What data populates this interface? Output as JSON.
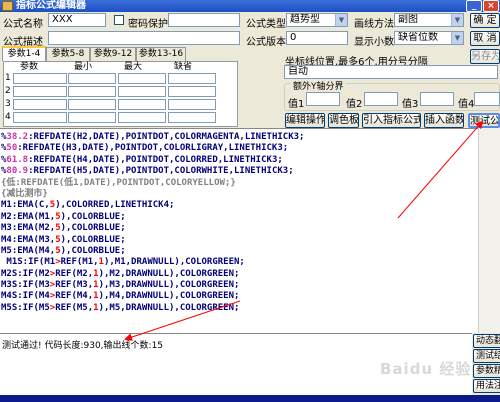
{
  "window": {
    "title": "指标公式编辑器"
  },
  "form": {
    "name_label": "公式名称",
    "name_value": "XXX",
    "password_label": "密码保护",
    "desc_label": "公式描述",
    "type_label": "公式类型",
    "type_value": "趋势型",
    "draw_label": "画线方法",
    "draw_value": "副图",
    "version_label": "公式版本",
    "version_value": "0",
    "decimal_label": "显示小数",
    "decimal_value": "缺省位数",
    "ok_label": "确 定",
    "cancel_label": "取 消",
    "saveas_label": "另存为"
  },
  "tabs": [
    "参数1-4",
    "参数5-8",
    "参数9-12",
    "参数13-16"
  ],
  "param_grid": {
    "headers": [
      "参数",
      "最小",
      "最大",
      "缺省"
    ],
    "rows": [
      "1",
      "2",
      "3",
      "4"
    ]
  },
  "coord": {
    "label": "坐标线位置,最多6个,用分号分隔",
    "value": "自动"
  },
  "axis_group": {
    "title": "额外Y轴分界",
    "labels": [
      "值1",
      "值2",
      "值3",
      "值4"
    ]
  },
  "actions": [
    "编辑操作",
    "调色板",
    "引入指标公式",
    "插入函数",
    "测试公式"
  ],
  "code_lines": [
    [
      {
        "t": "%",
        "c": "kw-dark"
      },
      {
        "t": "38.2",
        "c": "kw-mag"
      },
      {
        "t": ":REFDATE(H2,DATE),POINTDOT,COLORMAGENTA,LINETHICK3;",
        "c": "kw-dark"
      }
    ],
    [
      {
        "t": "%",
        "c": "kw-dark"
      },
      {
        "t": "50",
        "c": "kw-mag"
      },
      {
        "t": ":REFDATE(H3,DATE),POINTDOT,COLORLIGRAY,LINETHICK3;",
        "c": "kw-dark"
      }
    ],
    [
      {
        "t": "%",
        "c": "kw-dark"
      },
      {
        "t": "61.8",
        "c": "kw-mag"
      },
      {
        "t": ":REFDATE(H4,DATE),POINTDOT,COLORRED,LINETHICK3;",
        "c": "kw-dark"
      }
    ],
    [
      {
        "t": "%",
        "c": "kw-dark"
      },
      {
        "t": "80.9",
        "c": "kw-mag"
      },
      {
        "t": ":REFDATE(H5,DATE),POINTDOT,COLORWHITE,LINETHICK3;",
        "c": "kw-dark"
      }
    ],
    [
      {
        "t": "{低:REFDATE(低1,DATE),POINTDOT,COLORYELLOW;}",
        "c": "kw-gray"
      }
    ],
    [
      {
        "t": "{减比测市}",
        "c": "kw-gray"
      }
    ],
    [
      {
        "t": "M1:EMA(C,",
        "c": "kw-dark"
      },
      {
        "t": "5",
        "c": "kw-red"
      },
      {
        "t": "),COLORRED,LINETHICK4;",
        "c": "kw-dark"
      }
    ],
    [
      {
        "t": "M2:EMA(M1,",
        "c": "kw-dark"
      },
      {
        "t": "5",
        "c": "kw-red"
      },
      {
        "t": "),COLORBLUE;",
        "c": "kw-dark"
      }
    ],
    [
      {
        "t": "M3:EMA(M2,",
        "c": "kw-dark"
      },
      {
        "t": "5",
        "c": "kw-red"
      },
      {
        "t": "),COLORBLUE;",
        "c": "kw-dark"
      }
    ],
    [
      {
        "t": "M4:EMA(M3,",
        "c": "kw-dark"
      },
      {
        "t": "5",
        "c": "kw-red"
      },
      {
        "t": "),COLORBLUE;",
        "c": "kw-dark"
      }
    ],
    [
      {
        "t": "M5:EMA(M4,",
        "c": "kw-dark"
      },
      {
        "t": "5",
        "c": "kw-red"
      },
      {
        "t": "),COLORBLUE;",
        "c": "kw-dark"
      }
    ],
    [
      {
        "t": " M1S:IF(M1",
        "c": "kw-dark"
      },
      {
        "t": ">",
        "c": "kw-red"
      },
      {
        "t": "REF(M1,",
        "c": "kw-dark"
      },
      {
        "t": "1",
        "c": "kw-red"
      },
      {
        "t": "),M1,DRAWNULL),COLORGREEN;",
        "c": "kw-dark"
      }
    ],
    [
      {
        "t": "M2S:IF(M2",
        "c": "kw-dark"
      },
      {
        "t": ">",
        "c": "kw-red"
      },
      {
        "t": "REF(M2,",
        "c": "kw-dark"
      },
      {
        "t": "1",
        "c": "kw-red"
      },
      {
        "t": "),M2,DRAWNULL),COLORGREEN;",
        "c": "kw-dark"
      }
    ],
    [
      {
        "t": "M3S:IF(M3",
        "c": "kw-dark"
      },
      {
        "t": ">",
        "c": "kw-red"
      },
      {
        "t": "REF(M3,",
        "c": "kw-dark"
      },
      {
        "t": "1",
        "c": "kw-red"
      },
      {
        "t": "),M3,DRAWNULL),COLORGREEN;",
        "c": "kw-dark"
      }
    ],
    [
      {
        "t": "M4S:IF(M4",
        "c": "kw-dark"
      },
      {
        "t": ">",
        "c": "kw-red"
      },
      {
        "t": "REF(M4,",
        "c": "kw-dark"
      },
      {
        "t": "1",
        "c": "kw-red"
      },
      {
        "t": "),M4,DRAWNULL),COLORGREEN;",
        "c": "kw-dark"
      }
    ],
    [
      {
        "t": "M5S:IF(M5",
        "c": "kw-dark"
      },
      {
        "t": ">",
        "c": "kw-red"
      },
      {
        "t": "REF(M5,",
        "c": "kw-dark"
      },
      {
        "t": "1",
        "c": "kw-red"
      },
      {
        "t": "),M5,DRAWNULL),COLORGREEN;",
        "c": "kw-dark"
      }
    ]
  ],
  "status": {
    "text": "测试通过! 代码长度:930,输出线个数:15"
  },
  "side_buttons": [
    "动态翻",
    "测试结",
    "参数精",
    "用法注"
  ],
  "watermark": "Baidu 经验",
  "colors": {
    "arrow": "#ff0000",
    "title_bar": "#1d4fc4",
    "panel": "#ece9d8"
  }
}
